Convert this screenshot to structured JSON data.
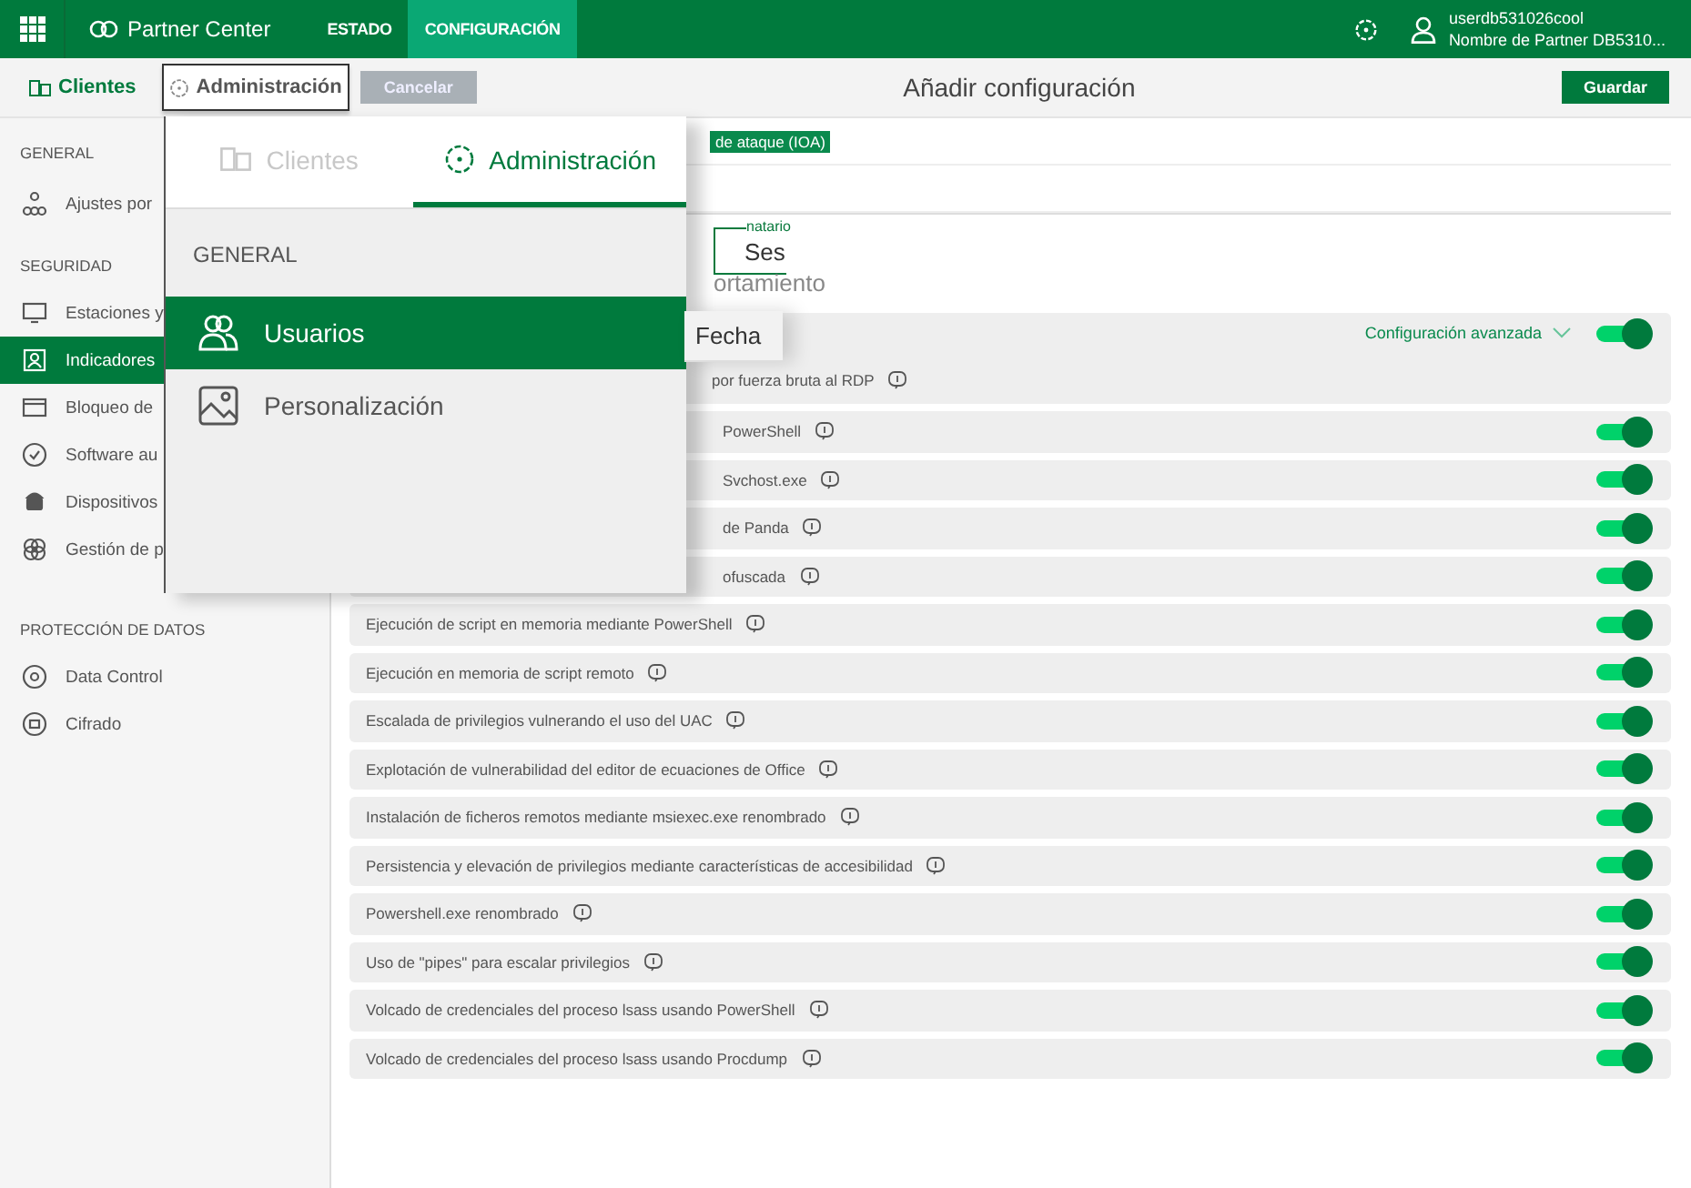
{
  "top_bar": {
    "logo": "Partner Center",
    "nav": [
      {
        "label": "ESTADO",
        "selected": false
      },
      {
        "label": "CONFIGURACIÓN",
        "selected": true
      }
    ],
    "user": {
      "name": "userdb531026cool",
      "partner": "Nombre de Partner DB5310..."
    }
  },
  "sub_bar": {
    "tabs": [
      {
        "label": "Clientes",
        "selected": true,
        "open": false
      },
      {
        "label": "Administración",
        "selected": false,
        "open": true
      }
    ],
    "cancel": "Cancelar",
    "title": "Añadir configuración",
    "save": "Guardar"
  },
  "sidebar": {
    "sections": [
      {
        "heading": "GENERAL",
        "items": [
          {
            "label": "Ajustes por",
            "selected": false
          }
        ]
      },
      {
        "heading": "SEGURIDAD",
        "items": [
          {
            "label": "Estaciones y",
            "selected": false
          },
          {
            "label": "Indicadores",
            "selected": true
          },
          {
            "label": "Bloqueo de",
            "selected": false
          },
          {
            "label": "Software au",
            "selected": false
          },
          {
            "label": "Dispositivos",
            "selected": false
          },
          {
            "label": "Gestión de p",
            "selected": false
          }
        ]
      },
      {
        "heading": "PROTECCIÓN DE DATOS",
        "items": [
          {
            "label": "Data Control",
            "selected": false
          },
          {
            "label": "Cifrado",
            "selected": false
          }
        ]
      }
    ]
  },
  "dropdown": {
    "tabs": [
      {
        "label": "Clientes",
        "selected": false
      },
      {
        "label": "Administración",
        "selected": true
      }
    ],
    "heading": "GENERAL",
    "items": [
      {
        "label": "Usuarios",
        "selected": true
      },
      {
        "label": "Personalización",
        "selected": false
      }
    ],
    "column_header": "Fecha"
  },
  "form": {
    "chip": "de ataque (IOA)",
    "field": {
      "label": "natario",
      "value": "Ses"
    },
    "heading": "ortamiento"
  },
  "rules": [
    {
      "kind": "group",
      "link": "Configuración avanzada",
      "label": "por fuerza bruta al RDP",
      "on": true
    },
    {
      "kind": "partial",
      "label": "PowerShell",
      "on": true
    },
    {
      "kind": "partial",
      "label": "Svchost.exe",
      "on": true
    },
    {
      "kind": "partial",
      "label": "de Panda",
      "on": true
    },
    {
      "kind": "partial",
      "label": "ofuscada",
      "on": true
    },
    {
      "kind": "full",
      "label": "Ejecución de script en memoria mediante PowerShell",
      "on": true
    },
    {
      "kind": "full",
      "label": "Ejecución en memoria de script remoto",
      "on": true
    },
    {
      "kind": "full",
      "label": "Escalada de privilegios vulnerando el uso del UAC",
      "on": true
    },
    {
      "kind": "full",
      "label": "Explotación de vulnerabilidad del editor de ecuaciones de Office",
      "on": true
    },
    {
      "kind": "full",
      "label": "Instalación de ficheros remotos mediante msiexec.exe renombrado",
      "on": true
    },
    {
      "kind": "full",
      "label": "Persistencia y elevación de privilegios mediante características de accesibilidad",
      "on": true
    },
    {
      "kind": "full",
      "label": "Powershell.exe renombrado",
      "on": true
    },
    {
      "kind": "full",
      "label": "Uso de \"pipes\" para escalar privilegios",
      "on": true
    },
    {
      "kind": "full",
      "label": "Volcado de credenciales del proceso lsass usando PowerShell",
      "on": true
    },
    {
      "kind": "full",
      "label": "Volcado de credenciales del proceso lsass usando Procdump",
      "on": true
    }
  ]
}
